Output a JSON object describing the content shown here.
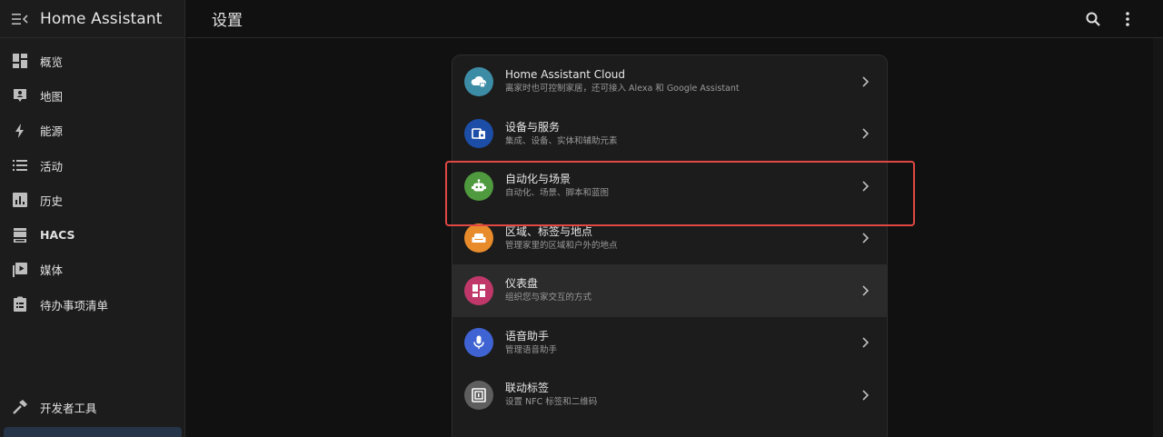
{
  "app": {
    "title": "Home Assistant"
  },
  "sidebar": {
    "items": [
      {
        "label": "概览",
        "icon": "dashboard-icon"
      },
      {
        "label": "地图",
        "icon": "map-account-icon"
      },
      {
        "label": "能源",
        "icon": "lightning-bolt-icon"
      },
      {
        "label": "活动",
        "icon": "format-list-icon"
      },
      {
        "label": "历史",
        "icon": "chart-box-icon"
      },
      {
        "label": "HACS",
        "icon": "hacs-icon"
      },
      {
        "label": "媒体",
        "icon": "play-box-multiple-icon"
      },
      {
        "label": "待办事项清单",
        "icon": "clipboard-list-icon"
      }
    ],
    "bottom_items": [
      {
        "label": "开发者工具",
        "icon": "hammer-icon"
      }
    ]
  },
  "header": {
    "title": "设置"
  },
  "settings": {
    "rows": [
      {
        "title": "Home Assistant Cloud",
        "subtitle": "离家时也可控制家居，还可接入 Alexa 和 Google Assistant",
        "icon": "cloud-lock-icon",
        "color": "#3d8ca6"
      },
      {
        "title": "设备与服务",
        "subtitle": "集成、设备、实体和辅助元素",
        "icon": "devices-icon",
        "color": "#1c4ea7"
      },
      {
        "title": "自动化与场景",
        "subtitle": "自动化、场景、脚本和蓝图",
        "icon": "robot-icon",
        "color": "#4f9a3e"
      },
      {
        "title": "区域、标签与地点",
        "subtitle": "管理家里的区域和户外的地点",
        "icon": "sofa-icon",
        "color": "#e88b2b"
      },
      {
        "title": "仪表盘",
        "subtitle": "组织您与家交互的方式",
        "icon": "view-dashboard-icon",
        "color": "#c0386a"
      },
      {
        "title": "语音助手",
        "subtitle": "管理语音助手",
        "icon": "microphone-icon",
        "color": "#3f63d2"
      },
      {
        "title": "联动标签",
        "subtitle": "设置 NFC 标签和二维码",
        "icon": "nfc-icon",
        "color": "#5e5e5e"
      }
    ]
  },
  "colors": {
    "highlight": "#e04844",
    "background": "#111111",
    "surface": "#1c1c1c"
  }
}
